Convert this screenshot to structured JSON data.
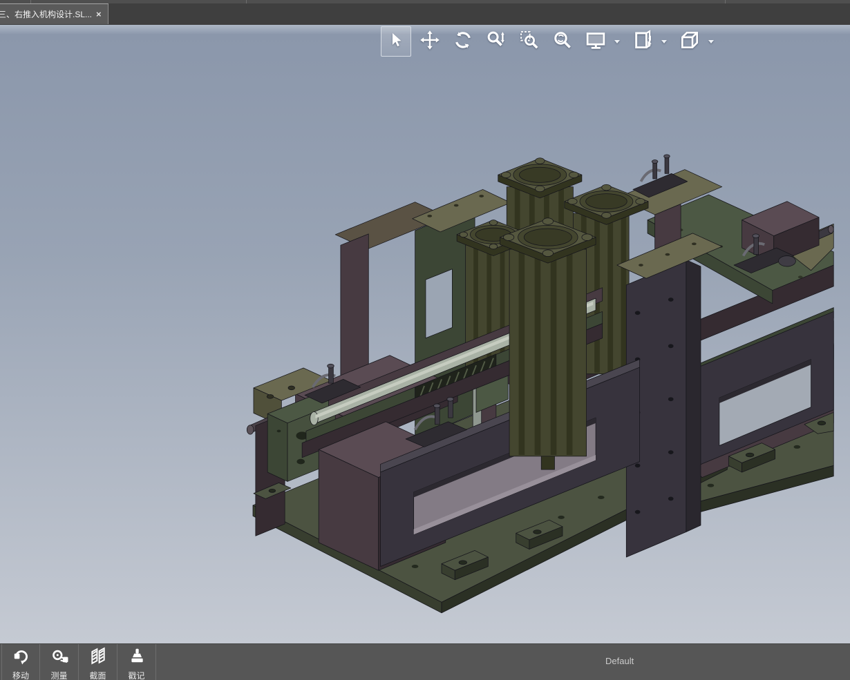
{
  "tab_bar": {
    "tabs": [
      {
        "title": "三、右推入机构设计.SL...",
        "close_icon": "×",
        "active": true
      }
    ]
  },
  "view_toolbar": {
    "tools": [
      {
        "name": "select",
        "icon": "cursor-arrow-icon",
        "selected": true,
        "has_dropdown": false
      },
      {
        "name": "pan",
        "icon": "pan-arrows-icon",
        "selected": false,
        "has_dropdown": false
      },
      {
        "name": "rotate",
        "icon": "rotate-arrows-icon",
        "selected": false,
        "has_dropdown": false
      },
      {
        "name": "zoom-in-out",
        "icon": "zoom-updown-icon",
        "selected": false,
        "has_dropdown": false
      },
      {
        "name": "zoom-to-area",
        "icon": "zoom-area-icon",
        "selected": false,
        "has_dropdown": false
      },
      {
        "name": "zoom-to-fit",
        "icon": "zoom-fit-icon",
        "selected": false,
        "has_dropdown": false
      },
      {
        "name": "full-screen",
        "icon": "monitor-icon",
        "selected": false,
        "has_dropdown": true
      },
      {
        "name": "view-modes",
        "icon": "sheet-arrows-icon",
        "selected": false,
        "has_dropdown": true
      },
      {
        "name": "standard-views",
        "icon": "cube-icon",
        "selected": false,
        "has_dropdown": true
      }
    ]
  },
  "command_bar": {
    "buttons": [
      {
        "label": "移动",
        "icon": "move-icon"
      },
      {
        "label": "测量",
        "icon": "measure-icon"
      },
      {
        "label": "截面",
        "icon": "section-icon"
      },
      {
        "label": "戳记",
        "icon": "stamp-icon"
      }
    ],
    "configuration": "Default"
  },
  "viewport": {
    "model": "右推入机构 twin pneumatic push-in fixture assembly",
    "colors": {
      "background_top": "#8b97ab",
      "background_bottom": "#c5cad3",
      "base_green": "#4c5341",
      "plum_gray": "#5a4b53",
      "olive_cylinder": "#44462f",
      "dark_frame": "#37333d",
      "light_rod": "#a9b2a5"
    }
  }
}
